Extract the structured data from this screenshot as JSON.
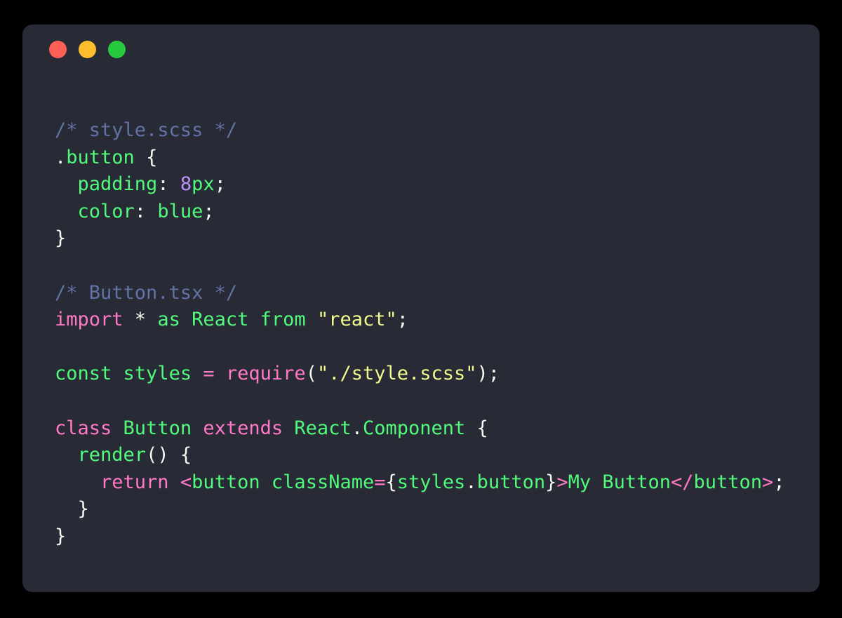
{
  "window": {
    "controls": [
      {
        "name": "close",
        "color": "#ff5f56"
      },
      {
        "name": "minimize",
        "color": "#ffbd2e"
      },
      {
        "name": "maximize",
        "color": "#27c93f"
      }
    ],
    "background": "#282a36",
    "page_background": "#000000"
  },
  "theme": {
    "comment": "#6272a4",
    "keyword": "#ff79c6",
    "identifier": "#50fa7b",
    "number": "#bd93f9",
    "string": "#f1fa8c",
    "plain": "#f8f8f2"
  },
  "code": {
    "language": "tsx",
    "lines": [
      {
        "id": "line-1",
        "tokens": [
          {
            "text": "/* style.scss */",
            "type": "comment"
          }
        ]
      },
      {
        "id": "line-2",
        "tokens": [
          {
            "text": ".",
            "type": "plain"
          },
          {
            "text": "button",
            "type": "identifier"
          },
          {
            "text": " {",
            "type": "plain"
          }
        ]
      },
      {
        "id": "line-3",
        "tokens": [
          {
            "text": "  ",
            "type": "plain"
          },
          {
            "text": "padding",
            "type": "identifier"
          },
          {
            "text": ": ",
            "type": "plain"
          },
          {
            "text": "8",
            "type": "number"
          },
          {
            "text": "px",
            "type": "identifier"
          },
          {
            "text": ";",
            "type": "plain"
          }
        ]
      },
      {
        "id": "line-4",
        "tokens": [
          {
            "text": "  ",
            "type": "plain"
          },
          {
            "text": "color",
            "type": "identifier"
          },
          {
            "text": ": ",
            "type": "plain"
          },
          {
            "text": "blue",
            "type": "identifier"
          },
          {
            "text": ";",
            "type": "plain"
          }
        ]
      },
      {
        "id": "line-5",
        "tokens": [
          {
            "text": "}",
            "type": "plain"
          }
        ]
      },
      {
        "id": "line-6",
        "tokens": []
      },
      {
        "id": "line-7",
        "tokens": [
          {
            "text": "/* Button.tsx */",
            "type": "comment"
          }
        ]
      },
      {
        "id": "line-8",
        "tokens": [
          {
            "text": "import",
            "type": "keyword"
          },
          {
            "text": " * ",
            "type": "plain"
          },
          {
            "text": "as",
            "type": "identifier"
          },
          {
            "text": " ",
            "type": "plain"
          },
          {
            "text": "React",
            "type": "identifier"
          },
          {
            "text": " ",
            "type": "plain"
          },
          {
            "text": "from",
            "type": "identifier"
          },
          {
            "text": " ",
            "type": "plain"
          },
          {
            "text": "\"react\"",
            "type": "string"
          },
          {
            "text": ";",
            "type": "plain"
          }
        ]
      },
      {
        "id": "line-9",
        "tokens": []
      },
      {
        "id": "line-10",
        "tokens": [
          {
            "text": "const",
            "type": "identifier"
          },
          {
            "text": " ",
            "type": "plain"
          },
          {
            "text": "styles",
            "type": "identifier"
          },
          {
            "text": " ",
            "type": "plain"
          },
          {
            "text": "=",
            "type": "keyword"
          },
          {
            "text": " ",
            "type": "plain"
          },
          {
            "text": "require",
            "type": "keyword"
          },
          {
            "text": "(",
            "type": "plain"
          },
          {
            "text": "\"./style.scss\"",
            "type": "string"
          },
          {
            "text": ");",
            "type": "plain"
          }
        ]
      },
      {
        "id": "line-11",
        "tokens": []
      },
      {
        "id": "line-12",
        "tokens": [
          {
            "text": "class",
            "type": "keyword"
          },
          {
            "text": " ",
            "type": "plain"
          },
          {
            "text": "Button",
            "type": "identifier"
          },
          {
            "text": " ",
            "type": "plain"
          },
          {
            "text": "extends",
            "type": "keyword"
          },
          {
            "text": " ",
            "type": "plain"
          },
          {
            "text": "React",
            "type": "identifier"
          },
          {
            "text": ".",
            "type": "plain"
          },
          {
            "text": "Component",
            "type": "identifier"
          },
          {
            "text": " {",
            "type": "plain"
          }
        ]
      },
      {
        "id": "line-13",
        "tokens": [
          {
            "text": "  ",
            "type": "plain"
          },
          {
            "text": "render",
            "type": "identifier"
          },
          {
            "text": "() {",
            "type": "plain"
          }
        ]
      },
      {
        "id": "line-14",
        "tokens": [
          {
            "text": "    ",
            "type": "plain"
          },
          {
            "text": "return",
            "type": "keyword"
          },
          {
            "text": " ",
            "type": "plain"
          },
          {
            "text": "<",
            "type": "keyword"
          },
          {
            "text": "button",
            "type": "identifier"
          },
          {
            "text": " ",
            "type": "plain"
          },
          {
            "text": "className",
            "type": "identifier"
          },
          {
            "text": "=",
            "type": "keyword"
          },
          {
            "text": "{",
            "type": "plain"
          },
          {
            "text": "styles",
            "type": "identifier"
          },
          {
            "text": ".",
            "type": "plain"
          },
          {
            "text": "button",
            "type": "identifier"
          },
          {
            "text": "}",
            "type": "plain"
          },
          {
            "text": ">",
            "type": "keyword"
          },
          {
            "text": "My Button",
            "type": "identifier"
          },
          {
            "text": "<",
            "type": "keyword"
          },
          {
            "text": "/",
            "type": "keyword"
          },
          {
            "text": "button",
            "type": "identifier"
          },
          {
            "text": ">",
            "type": "keyword"
          },
          {
            "text": ";",
            "type": "plain"
          }
        ]
      },
      {
        "id": "line-15",
        "tokens": [
          {
            "text": "  }",
            "type": "plain"
          }
        ]
      },
      {
        "id": "line-16",
        "tokens": [
          {
            "text": "}",
            "type": "plain"
          }
        ]
      }
    ]
  }
}
